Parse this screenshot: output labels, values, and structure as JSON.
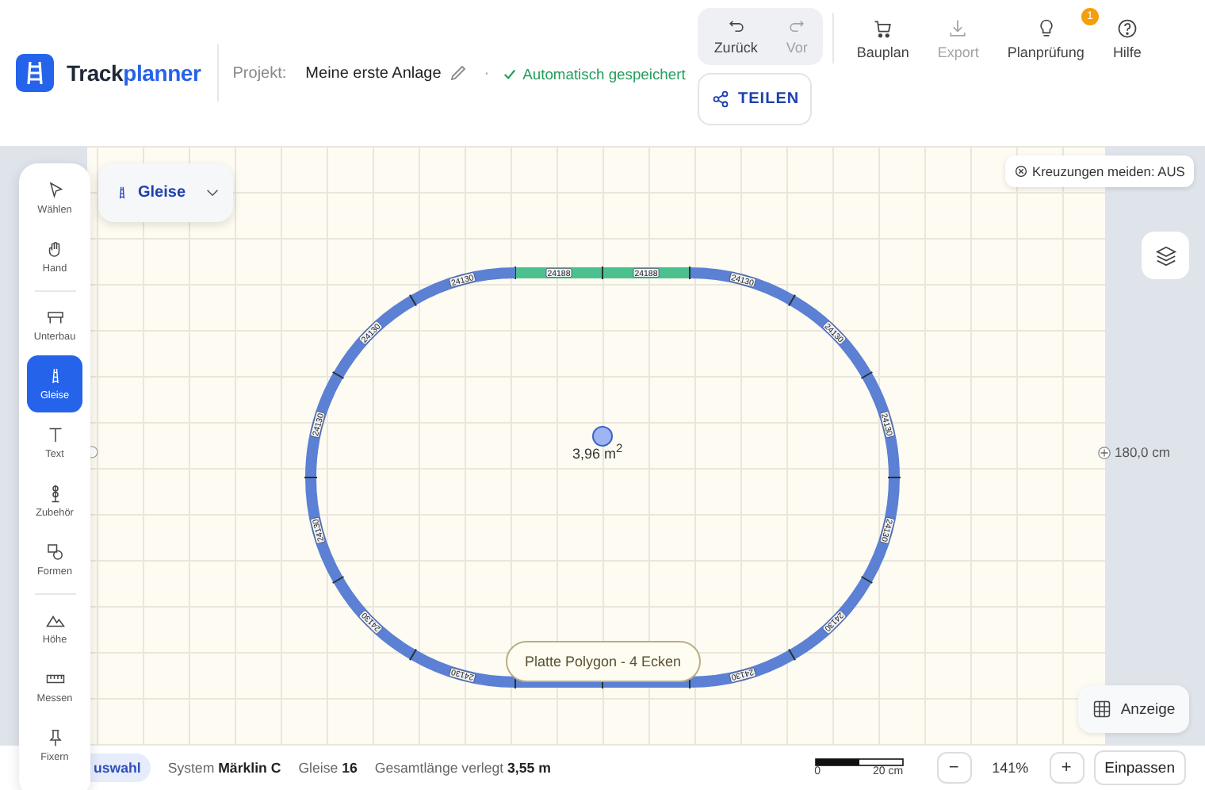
{
  "header": {
    "logo": {
      "first": "Track",
      "second": "planner"
    },
    "project_label": "Projekt:",
    "project_name": "Meine erste Anlage",
    "separator": "·",
    "save_status": "Automatisch gespeichert",
    "history": [
      {
        "label": "Zurück",
        "disabled": false
      },
      {
        "label": "Vor",
        "disabled": true
      }
    ],
    "actions": [
      {
        "label": "Bauplan",
        "disabled": false
      },
      {
        "label": "Export",
        "disabled": true
      },
      {
        "label": "Planprüfung",
        "disabled": false,
        "badge": "1"
      },
      {
        "label": "Hilfe",
        "disabled": false
      }
    ],
    "share": "TEILEN"
  },
  "toolbar": [
    [
      {
        "label": "Wählen",
        "selected": false
      },
      {
        "label": "Hand",
        "selected": false
      }
    ],
    [
      {
        "label": "Unterbau",
        "selected": false
      },
      {
        "label": "Gleise",
        "selected": true
      },
      {
        "label": "Text",
        "selected": false
      },
      {
        "label": "Zubehör",
        "selected": false
      },
      {
        "label": "Formen",
        "selected": false
      }
    ],
    [
      {
        "label": "Höhe",
        "selected": false
      },
      {
        "label": "Messen",
        "selected": false
      },
      {
        "label": "Fixern",
        "selected": false
      }
    ]
  ],
  "category_dropdown": "Gleise",
  "crossing_toggle": "Kreuzungen meiden: AUS",
  "display_button": "Anzeige",
  "canvas": {
    "area": "3,96 m$^{2}$",
    "width_marker": "180,0 cm",
    "tooltip": "Platte Polygon - 4 Ecken",
    "tracks": [
      {
        "kind": "straight",
        "label": "24188",
        "selected": true
      },
      {
        "kind": "straight",
        "label": "24188",
        "selected": true
      },
      {
        "kind": "curve",
        "label": "24130",
        "selected": false
      },
      {
        "kind": "curve",
        "label": "24130",
        "selected": false
      },
      {
        "kind": "curve",
        "label": "24130",
        "selected": false
      },
      {
        "kind": "curve",
        "label": "24130",
        "selected": false
      },
      {
        "kind": "curve",
        "label": "24130",
        "selected": false
      },
      {
        "kind": "curve",
        "label": "24130",
        "selected": false
      },
      {
        "kind": "straight",
        "selected": false
      },
      {
        "kind": "straight",
        "selected": false
      },
      {
        "kind": "curve",
        "label": "24130",
        "selected": false
      },
      {
        "kind": "curve",
        "label": "24130",
        "selected": false
      },
      {
        "kind": "curve",
        "label": "24130",
        "selected": false
      },
      {
        "kind": "curve",
        "label": "24130",
        "selected": false
      },
      {
        "kind": "curve",
        "label": "24130",
        "selected": false
      },
      {
        "kind": "curve",
        "label": "24130",
        "selected": false
      }
    ]
  },
  "status_bar": {
    "selection_chip": "uswahl",
    "system_label": "System",
    "system_value": "Märklin C",
    "tracks_label": "Gleise",
    "tracks_value": "16",
    "length_label": "Gesamtlänge verlegt",
    "length_value": "3,55 m",
    "scale_start": "0",
    "scale_end": "20 cm",
    "zoom_out": "−",
    "zoom": "141%",
    "zoom_in": "+",
    "fit": "Einpassen"
  }
}
